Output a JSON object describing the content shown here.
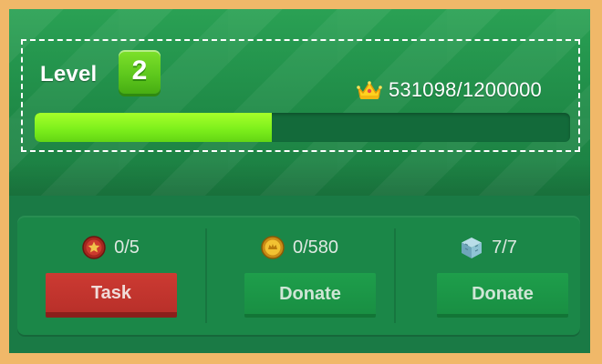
{
  "level": {
    "label": "Level",
    "value": "2"
  },
  "experience": {
    "text": "531098/1200000",
    "current": 531098,
    "max": 1200000,
    "progress_fraction": 0.4426,
    "icon": "crown-icon"
  },
  "rewards": [
    {
      "icon": "star-medal-icon",
      "count_text": "0/5",
      "button_label": "Task",
      "button_color": "#c53631"
    },
    {
      "icon": "coin-icon",
      "count_text": "0/580",
      "button_label": "Donate",
      "button_color": "#1b9748"
    },
    {
      "icon": "cube-icon",
      "count_text": "7/7",
      "button_label": "Donate",
      "button_color": "#1b9748"
    }
  ],
  "colors": {
    "frame": "#f0b869",
    "panel": "#1a7a45",
    "progress_fill": "#7ef01c",
    "progress_track": "#136a3a"
  }
}
